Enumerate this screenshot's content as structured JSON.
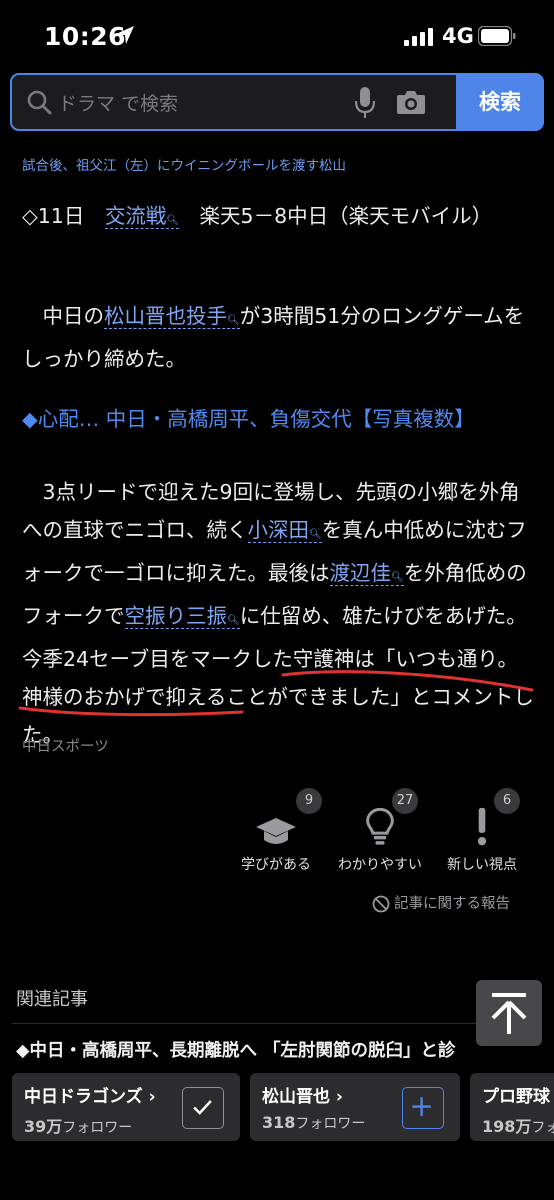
{
  "status": {
    "time": "10:26",
    "network": "4G"
  },
  "search": {
    "placeholder": "ドラマ で検索",
    "button": "検索"
  },
  "article": {
    "caption": "試合後、祖父江（左）にウイニングボールを渡す松山",
    "p1": {
      "t1": "◇11日　",
      "link1": "交流戦",
      "t2": "　楽天5－8中日（楽天モバイル）"
    },
    "p2": {
      "t1": "　中日の",
      "link1": "松山晋也投手",
      "t2": "が3時間51分のロングゲームをしっかり締めた。"
    },
    "p3": {
      "text": "◆心配… 中日・高橋周平、負傷交代【写真複数】"
    },
    "p4": {
      "t1": "　3点リードで迎えた9回に登場し、先頭の小郷を外角への直球でニゴロ、続く",
      "link1": "小深田",
      "t2": "を真ん中低めに沈むフォークで一ゴロに抑えた。最後は",
      "link2": "渡辺佳",
      "t3": "を外角低めのフォークで",
      "link3": "空振り三振",
      "t4": "に仕留め、雄たけびをあげた。今季24セーブ目をマークした守護神は「いつも通り。神様のおかげで抑えることができました」とコメントした。"
    },
    "source": "中日スポーツ"
  },
  "reactions": [
    {
      "label": "学びがある",
      "count": "9",
      "icon": "graduation-cap-icon"
    },
    {
      "label": "わかりやすい",
      "count": "27",
      "icon": "lightbulb-icon"
    },
    {
      "label": "新しい視点",
      "count": "6",
      "icon": "exclamation-icon"
    }
  ],
  "report": "記事に関する報告",
  "related": {
    "title": "関連記事",
    "item1": "◆中日・高橋周平、長期離脱へ 「左肘関節の脱臼」と診"
  },
  "follow": [
    {
      "name": "中日ドラゴンズ",
      "count": "39",
      "unit": "万",
      "suffix": "フォロワー",
      "state": "check"
    },
    {
      "name": "松山晋也",
      "count": "318",
      "unit": "",
      "suffix": "フォロワー",
      "state": "plus"
    },
    {
      "name": "プロ野球",
      "count": "198",
      "unit": "万",
      "suffix": "フォロワー",
      "state": "none"
    }
  ],
  "colors": {
    "accent": "#4f84e8",
    "link": "#7ea6f2",
    "underline": "#e0322e",
    "background": "#000000"
  }
}
